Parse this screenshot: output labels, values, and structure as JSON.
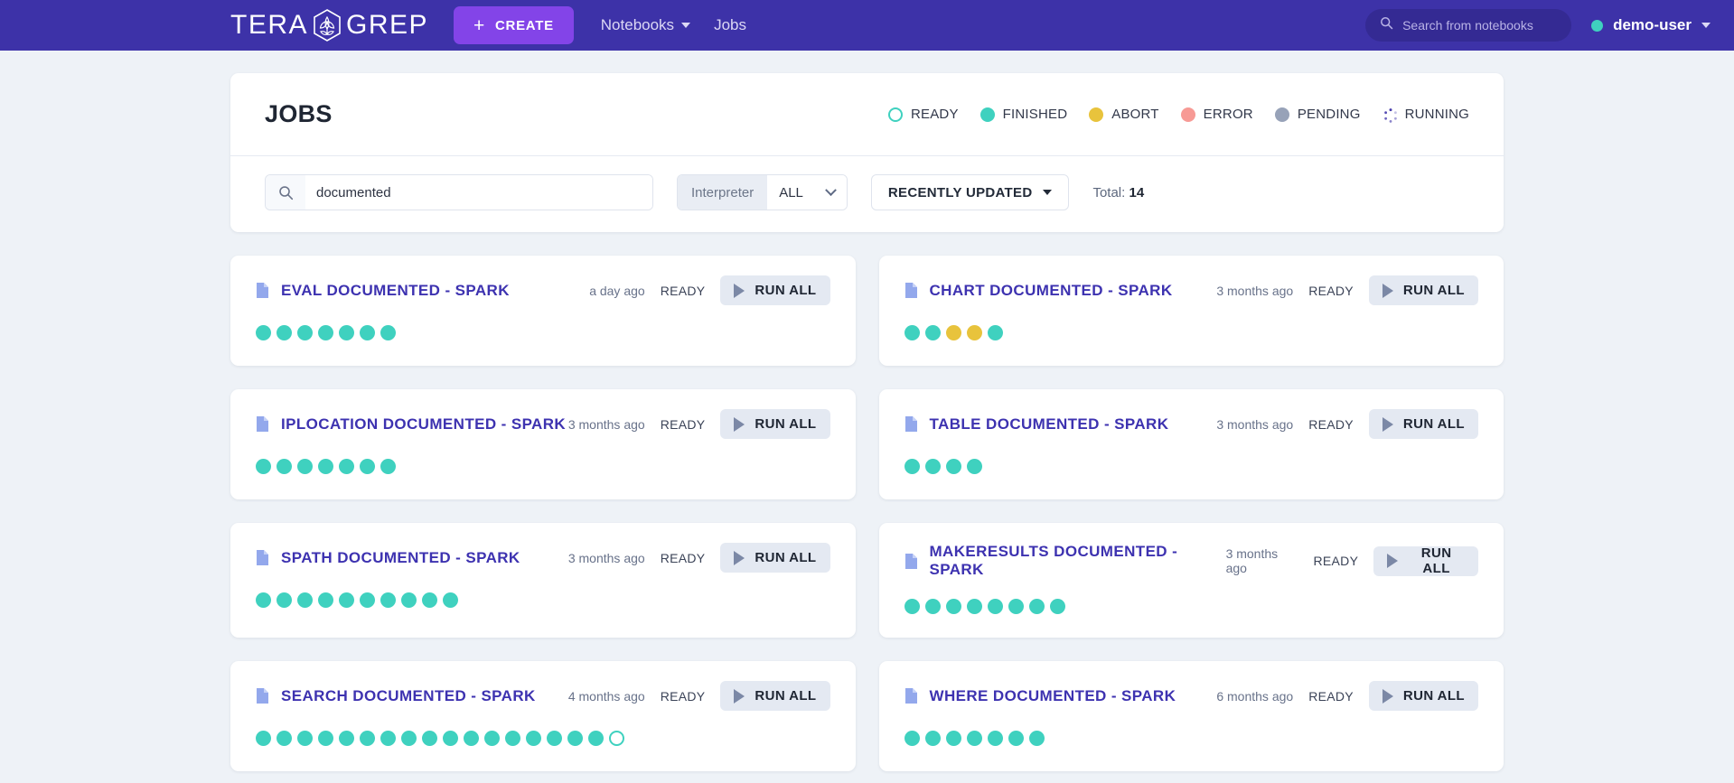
{
  "navbar": {
    "brand_left": "TERA",
    "brand_right": "GREP",
    "create_label": "CREATE",
    "create_plus": "+",
    "links": [
      {
        "label": "Notebooks",
        "has_caret": true
      },
      {
        "label": "Jobs",
        "has_caret": false
      }
    ],
    "search_placeholder": "Search from notebooks",
    "user_name": "demo-user",
    "accent_purple": "#3d32a8",
    "create_purple": "#8344e8",
    "user_dot_color": "#3fd1bf"
  },
  "header": {
    "title": "JOBS",
    "legend": [
      {
        "label": "READY",
        "status": "ready",
        "color": "#3fd1bf"
      },
      {
        "label": "FINISHED",
        "status": "finished",
        "color": "#3fd1bf"
      },
      {
        "label": "ABORT",
        "status": "abort",
        "color": "#e8c33c"
      },
      {
        "label": "ERROR",
        "status": "error",
        "color": "#f79a95"
      },
      {
        "label": "PENDING",
        "status": "pending",
        "color": "#97a2b8"
      },
      {
        "label": "RUNNING",
        "status": "running",
        "color": "#3d32a8"
      }
    ]
  },
  "filters": {
    "search_value": "documented",
    "search_placeholder": "",
    "interpreter_label": "Interpreter",
    "interpreter_value": "ALL",
    "sort_label": "RECENTLY UPDATED",
    "total_label": "Total:",
    "total_count": "14"
  },
  "jobs": [
    {
      "title": "EVAL DOCUMENTED - SPARK",
      "time": "a day ago",
      "state": "READY",
      "run_label": "RUN ALL",
      "paragraphs": [
        "finished",
        "finished",
        "finished",
        "finished",
        "finished",
        "finished",
        "finished"
      ]
    },
    {
      "title": "CHART DOCUMENTED - SPARK",
      "time": "3 months ago",
      "state": "READY",
      "run_label": "RUN ALL",
      "paragraphs": [
        "finished",
        "finished",
        "abort",
        "abort",
        "finished"
      ]
    },
    {
      "title": "IPLOCATION DOCUMENTED - SPARK",
      "time": "3 months ago",
      "state": "READY",
      "run_label": "RUN ALL",
      "paragraphs": [
        "finished",
        "finished",
        "finished",
        "finished",
        "finished",
        "finished",
        "finished"
      ]
    },
    {
      "title": "TABLE DOCUMENTED - SPARK",
      "time": "3 months ago",
      "state": "READY",
      "run_label": "RUN ALL",
      "paragraphs": [
        "finished",
        "finished",
        "finished",
        "finished"
      ]
    },
    {
      "title": "SPATH DOCUMENTED - SPARK",
      "time": "3 months ago",
      "state": "READY",
      "run_label": "RUN ALL",
      "paragraphs": [
        "finished",
        "finished",
        "finished",
        "finished",
        "finished",
        "finished",
        "finished",
        "finished",
        "finished",
        "finished"
      ]
    },
    {
      "title": "MAKERESULTS DOCUMENTED - SPARK",
      "time": "3 months ago",
      "state": "READY",
      "run_label": "RUN ALL",
      "paragraphs": [
        "finished",
        "finished",
        "finished",
        "finished",
        "finished",
        "finished",
        "finished",
        "finished"
      ]
    },
    {
      "title": "SEARCH DOCUMENTED - SPARK",
      "time": "4 months ago",
      "state": "READY",
      "run_label": "RUN ALL",
      "paragraphs": [
        "finished",
        "finished",
        "finished",
        "finished",
        "finished",
        "finished",
        "finished",
        "finished",
        "finished",
        "finished",
        "finished",
        "finished",
        "finished",
        "finished",
        "finished",
        "finished",
        "finished",
        "ready"
      ]
    },
    {
      "title": "WHERE DOCUMENTED - SPARK",
      "time": "6 months ago",
      "state": "READY",
      "run_label": "RUN ALL",
      "paragraphs": [
        "finished",
        "finished",
        "finished",
        "finished",
        "finished",
        "finished",
        "finished"
      ]
    }
  ]
}
